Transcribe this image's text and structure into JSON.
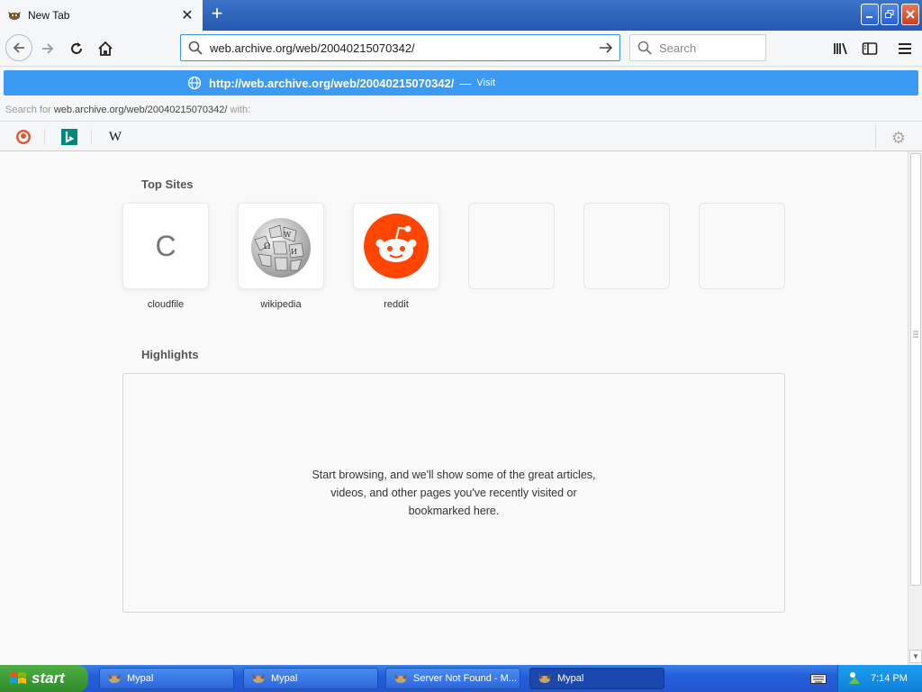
{
  "browser": {
    "tab": {
      "title": "New Tab",
      "close_icon": "close-icon"
    },
    "new_tab_icon": "plus-icon",
    "window_controls": [
      "minimize",
      "maximize",
      "close"
    ],
    "address": "web.archive.org/web/20040215070342/",
    "search_placeholder": "Search",
    "autocomplete": {
      "url": "http://web.archive.org/web/20040215070342/",
      "separator": "—",
      "action": "Visit",
      "search_for_prefix": "Search for",
      "search_for_query": "web.archive.org/web/20040215070342/",
      "search_for_suffix": "with:"
    },
    "search_engines": [
      "duckduckgo",
      "bing",
      "wikipedia"
    ]
  },
  "newtab": {
    "top_sites_title": "Top Sites",
    "sites": [
      {
        "label": "cloudfile",
        "letter": "C"
      },
      {
        "label": "wikipedia"
      },
      {
        "label": "reddit"
      },
      {
        "label": ""
      },
      {
        "label": ""
      },
      {
        "label": ""
      }
    ],
    "highlights_title": "Highlights",
    "highlights_message": "Start browsing, and we'll show some of the great articles, videos, and other pages you've recently visited or bookmarked here."
  },
  "taskbar": {
    "start_label": "start",
    "tasks": [
      {
        "label": "Mypal",
        "active": false
      },
      {
        "label": "Mypal",
        "active": false
      },
      {
        "label": "Server Not Found - M...",
        "active": false
      },
      {
        "label": "Mypal",
        "active": true
      }
    ],
    "clock": "7:14 PM"
  },
  "colors": {
    "accent": "#3c9af3",
    "reddit": "#ff4500",
    "taskbar": "#245edb",
    "start": "#3a9a33"
  }
}
